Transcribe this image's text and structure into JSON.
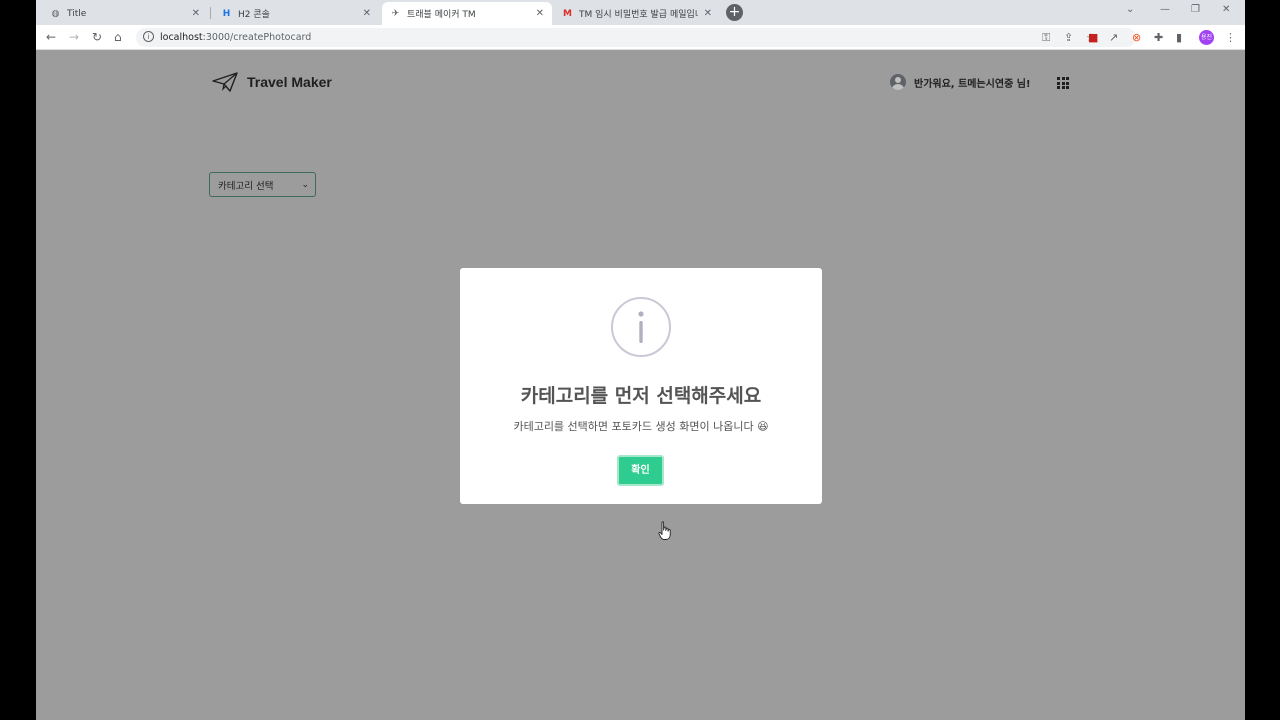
{
  "browser": {
    "tabs": [
      {
        "title": "Title",
        "favicon": "globe-icon",
        "active": false
      },
      {
        "title": "H2 콘솔",
        "favicon": "h2-icon",
        "active": false
      },
      {
        "title": "트래블 메이커 TM",
        "favicon": "paper-plane-icon",
        "active": true
      },
      {
        "title": "TM 임시 비밀번호 발급 메일입니",
        "favicon": "gmail-icon",
        "active": false
      }
    ],
    "url_host": "localhost",
    "url_path": ":3000/createPhotocard",
    "profile_initials": "용진"
  },
  "header": {
    "brand": "Travel Maker",
    "greeting": "반가워요, 트메는시연중 님!"
  },
  "category_select": {
    "selected": "카테고리 선택"
  },
  "modal": {
    "title": "카테고리를 먼저 선택해주세요",
    "text": "카테고리를 선택하면 포토카드 생성 화면이 나옵니다 😆",
    "confirm": "확인"
  },
  "colors": {
    "confirm_button": "#2ecc8f",
    "overlay": "#9c9c9c",
    "profile": "#a142f4"
  }
}
